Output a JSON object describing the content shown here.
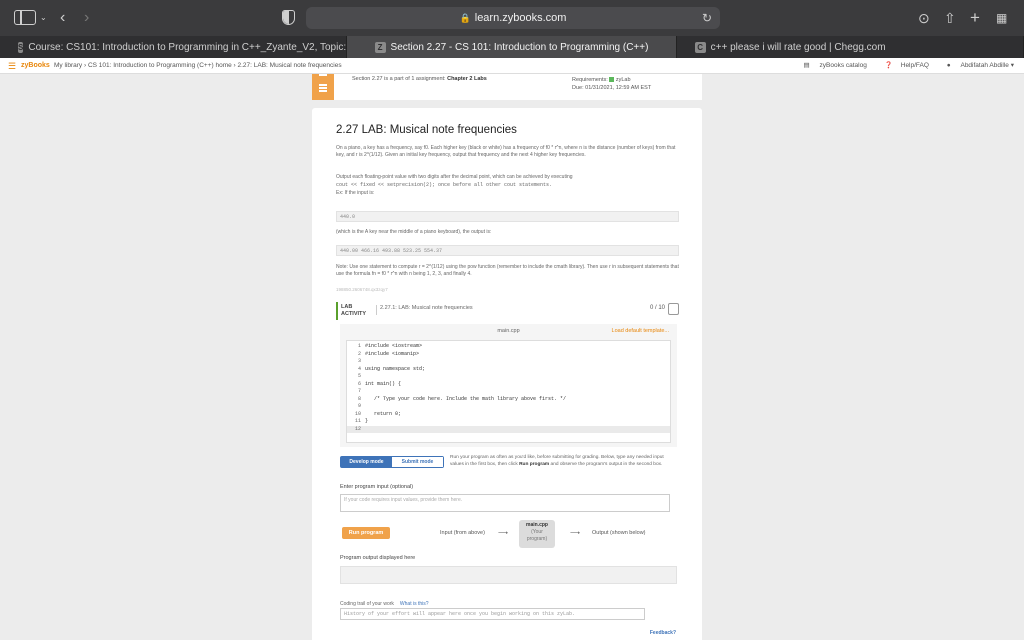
{
  "browser": {
    "url": "learn.zybooks.com",
    "tabs": [
      {
        "label": "Course: CS101: Introduction to Programming in C++_Zyante_V2, Topic: Topic 2...",
        "icon": "S"
      },
      {
        "label": "Section 2.27 - CS 101: Introduction to Programming (C++)",
        "icon": "Z"
      },
      {
        "label": "c++ please i will rate good | Chegg.com",
        "icon": "C"
      }
    ]
  },
  "zybar": {
    "logo": "zyBooks",
    "breadcrumbs": "My library › CS 101: Introduction to Programming (C++) home › 2.27: LAB: Musical note frequencies",
    "catalog": "zyBooks catalog",
    "help": "Help/FAQ",
    "user": "Abdifatah Abdille"
  },
  "section_header": {
    "section": "Section 2.27 is a part of 1 assignment:",
    "assignment": "Chapter 2 Labs",
    "requirements": "Requirements:",
    "req_type": "zyLab",
    "due": "Due: 01/31/2021, 12:59 AM EST"
  },
  "lab": {
    "title": "2.27 LAB: Musical note frequencies",
    "para1": "On a piano, a key has a frequency, say f0. Each higher key (black or white) has a frequency of f0 * r^n, where n is the distance (number of keys) from that key, and r is 2^(1/12). Given an initial key frequency, output that frequency and the next 4 higher key frequencies.",
    "para2": "Output each floating-point value with two digits after the decimal point, which can be achieved by executing",
    "para3": "cout << fixed << setprecision(2); once before all other cout statements.",
    "para4": "Ex: If the input is:",
    "example_input": "440.0",
    "para5": "(which is the A key near the middle of a piano keyboard), the output is:",
    "example_output": "440.00 466.16 493.88 523.25 554.37",
    "para6": "Note: Use one statement to compute r = 2^(1/12) using the pow function (remember to include the cmath library). Then use r in subsequent statements that use the formula fn = f0 * r^n with n being 1, 2, 3, and finally 4.",
    "problem_id": "198850.2606748.qx3zqy7"
  },
  "activity": {
    "label_line1": "LAB",
    "label_line2": "ACTIVITY",
    "name": "2.27.1: LAB: Musical note frequencies",
    "score": "0 / 10",
    "filename": "main.cpp",
    "load_template": "Load default template...",
    "code_lines": [
      {
        "n": "1",
        "text": "#include <iostream>"
      },
      {
        "n": "2",
        "text": "#include <iomanip>"
      },
      {
        "n": "3",
        "text": ""
      },
      {
        "n": "4",
        "text": "using namespace std;"
      },
      {
        "n": "5",
        "text": ""
      },
      {
        "n": "6",
        "text": "int main() {"
      },
      {
        "n": "7",
        "text": ""
      },
      {
        "n": "8",
        "text": "   /* Type your code here. Include the math library above first. */"
      },
      {
        "n": "9",
        "text": ""
      },
      {
        "n": "10",
        "text": "   return 0;"
      },
      {
        "n": "11",
        "text": "}"
      },
      {
        "n": "12",
        "text": ""
      }
    ],
    "develop_mode": "Develop mode",
    "submit_mode": "Submit mode",
    "mode_desc_a": "Run your program as often as you'd like, before submitting for grading. Below, type any needed input values in the first box, then click ",
    "mode_desc_b": "Run program",
    "mode_desc_c": " and observe the program's output in the second box.",
    "input_label": "Enter program input (optional)",
    "input_placeholder": "If your code requires input values, provide them here.",
    "run_button": "Run program",
    "input_from": "Input (from above)",
    "prog_name": "main.cpp",
    "prog_sub1": "(Your",
    "prog_sub2": "program)",
    "output_to": "Output (shown below)",
    "output_label": "Program output displayed here",
    "trail_label": "Coding trail of your work",
    "trail_link": "What is this?",
    "trail_text": "History of your effort will appear here once you begin working on this zyLab.",
    "feedback": "Feedback?"
  }
}
